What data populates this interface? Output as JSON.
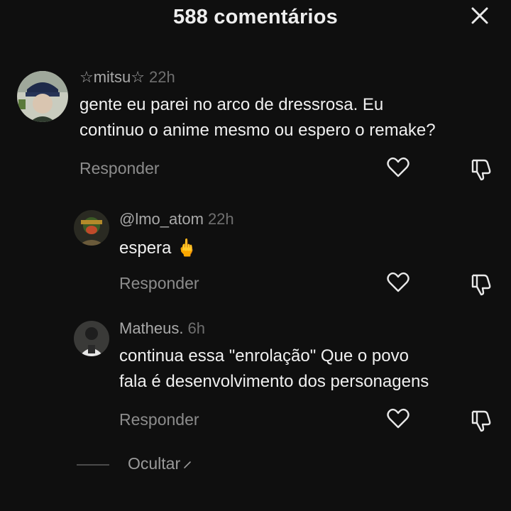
{
  "header": {
    "title": "588 comentários"
  },
  "comments": [
    {
      "username": "☆mitsu☆",
      "time": "22h",
      "lines": [
        "gente eu parei no arco de dressrosa. Eu",
        "continuo o anime mesmo ou espero o remake?"
      ],
      "reply_label": "Responder"
    },
    {
      "username": "@lmo_atom",
      "time": "22h",
      "lines": [
        "espera 🖕"
      ],
      "reply_label": "Responder"
    },
    {
      "username": "Matheus.",
      "time": "6h",
      "lines": [
        "continua essa \"enrolação\" Que o povo",
        "fala é desenvolvimento dos personagens"
      ],
      "reply_label": "Responder"
    }
  ],
  "footer": {
    "hide_label": "Ocultar"
  },
  "colors": {
    "background": "#0f0f0f",
    "text": "#f0f0f0",
    "muted": "#8c8c8c"
  }
}
